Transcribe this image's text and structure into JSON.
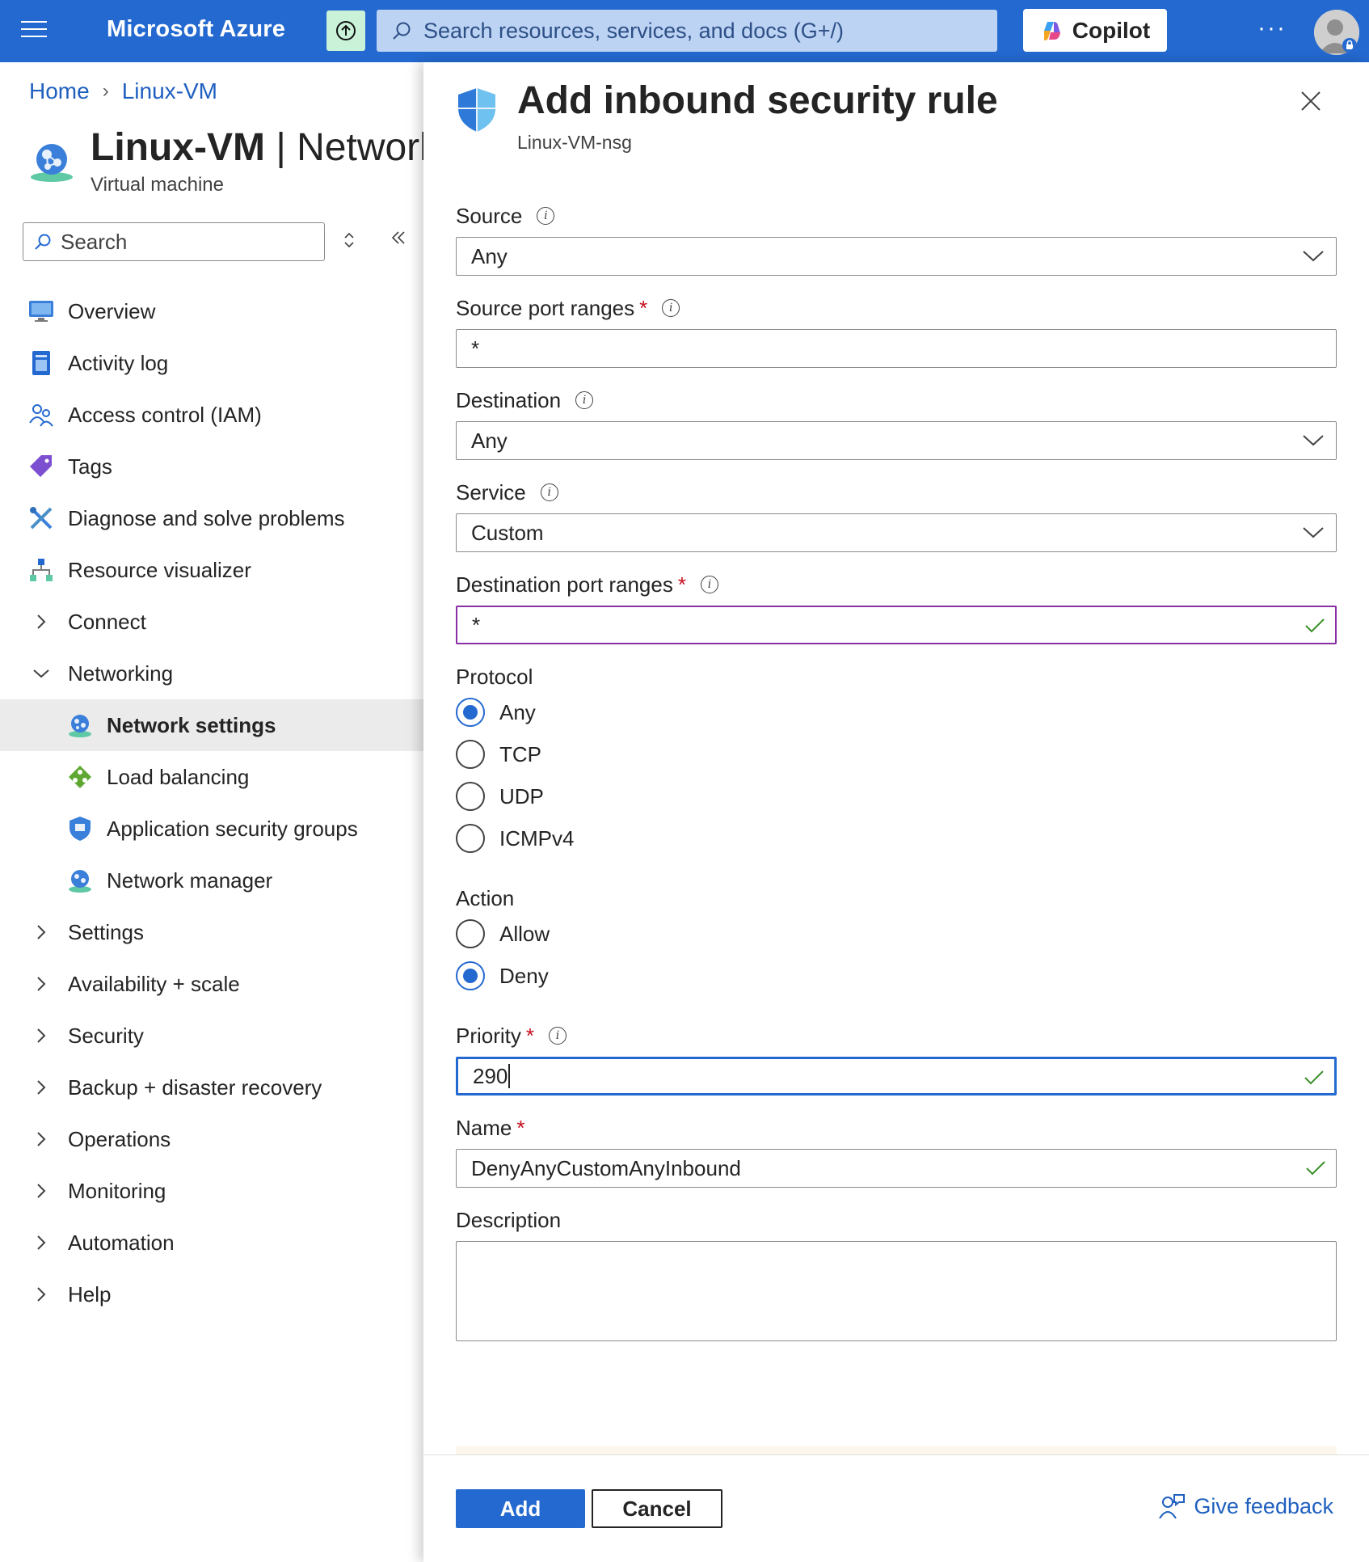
{
  "topbar": {
    "brand": "Microsoft Azure",
    "search_placeholder": "Search resources, services, and docs (G+/)",
    "copilot_label": "Copilot",
    "more_label": "···"
  },
  "breadcrumb": {
    "home": "Home",
    "resource": "Linux-VM"
  },
  "resource": {
    "name": "Linux-VM",
    "section": " | Networl",
    "type": "Virtual machine"
  },
  "left_search": {
    "placeholder": "Search"
  },
  "nav": {
    "overview": "Overview",
    "activity_log": "Activity log",
    "access_control": "Access control (IAM)",
    "tags": "Tags",
    "diagnose": "Diagnose and solve problems",
    "resource_visualizer": "Resource visualizer",
    "connect": "Connect",
    "networking": "Networking",
    "network_settings": "Network settings",
    "load_balancing": "Load balancing",
    "app_security_groups": "Application security groups",
    "network_manager": "Network manager",
    "settings": "Settings",
    "availability": "Availability + scale",
    "security": "Security",
    "backup": "Backup + disaster recovery",
    "operations": "Operations",
    "monitoring": "Monitoring",
    "automation": "Automation",
    "help": "Help"
  },
  "panel": {
    "title": "Add inbound security rule",
    "subtitle": "Linux-VM-nsg",
    "source": {
      "label": "Source",
      "value": "Any"
    },
    "source_port_ranges": {
      "label": "Source port ranges",
      "value": "*"
    },
    "destination": {
      "label": "Destination",
      "value": "Any"
    },
    "service": {
      "label": "Service",
      "value": "Custom"
    },
    "destination_port_ranges": {
      "label": "Destination port ranges",
      "value": "*"
    },
    "protocol": {
      "label": "Protocol",
      "options": [
        "Any",
        "TCP",
        "UDP",
        "ICMPv4"
      ],
      "selected": "Any"
    },
    "action": {
      "label": "Action",
      "options": [
        "Allow",
        "Deny"
      ],
      "selected": "Deny"
    },
    "priority": {
      "label": "Priority",
      "value": "290"
    },
    "name": {
      "label": "Name",
      "value": "DenyAnyCustomAnyInbound"
    },
    "description": {
      "label": "Description",
      "value": ""
    },
    "add_label": "Add",
    "cancel_label": "Cancel",
    "feedback_label": "Give feedback"
  },
  "colors": {
    "topbar": "#2469d0",
    "accent": "#2469d0",
    "required": "#c50f1f",
    "valid_check": "#3b8f2a",
    "selected_nav": "#ebebeb"
  }
}
